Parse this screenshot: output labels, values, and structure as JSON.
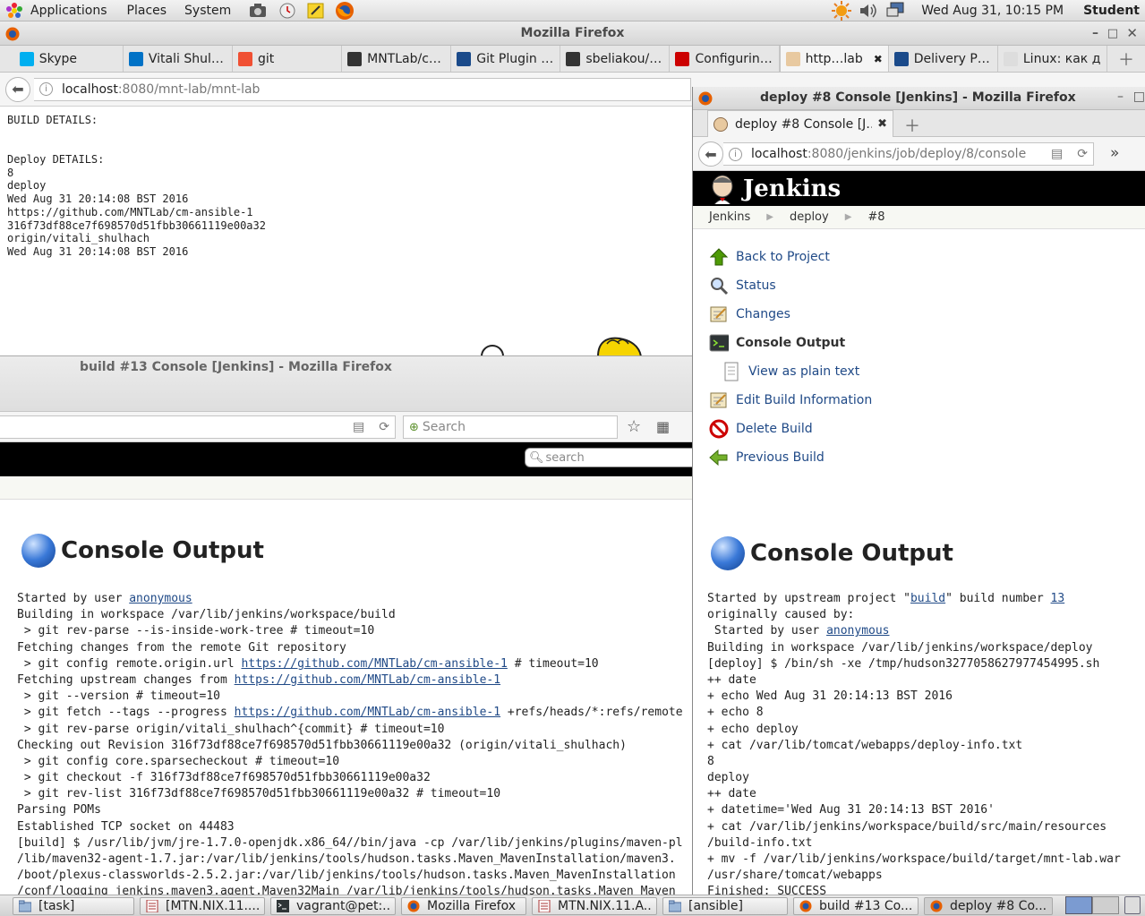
{
  "topbar": {
    "menus": [
      "Applications",
      "Places",
      "System"
    ],
    "clock": "Wed Aug 31, 10:15 PM",
    "user": "Student"
  },
  "main_window": {
    "title": "Mozilla Firefox",
    "tabs": [
      "Skype",
      "Vitali Shul…",
      "git",
      "MNTLab/c…",
      "Git Plugin …",
      "sbeliakou/…",
      "Configurin…",
      "http…lab",
      "Delivery P…",
      "Linux: как до…"
    ],
    "active_tab": 7,
    "url_host": "localhost",
    "url_rest": ":8080/mnt-lab/mnt-lab",
    "page_lines": [
      "BUILD DETAILS:",
      "",
      "",
      "Deploy DETAILS:",
      "8",
      "deploy",
      "Wed Aug 31 20:14:08 BST 2016",
      "https://github.com/MNTLab/cm-ansible-1",
      "316f73df88ce7f698570d51fbb30661119e00a32",
      "origin/vitali_shulhach",
      "Wed Aug 31 20:14:08 BST 2016"
    ]
  },
  "back_window": {
    "title": "build #13 Console [Jenkins] - Mozilla Firefox",
    "search_placeholder": "Search",
    "jenkins_search_placeholder": "search",
    "heading": "Console Output",
    "lines": [
      [
        {
          "t": "Started by user "
        },
        {
          "t": "anonymous",
          "link": true
        }
      ],
      [
        {
          "t": "Building in workspace /var/lib/jenkins/workspace/build"
        }
      ],
      [
        {
          "t": " > git rev-parse --is-inside-work-tree # timeout=10"
        }
      ],
      [
        {
          "t": "Fetching changes from the remote Git repository"
        }
      ],
      [
        {
          "t": " > git config remote.origin.url "
        },
        {
          "t": "https://github.com/MNTLab/cm-ansible-1",
          "link": true
        },
        {
          "t": " # timeout=10"
        }
      ],
      [
        {
          "t": "Fetching upstream changes from "
        },
        {
          "t": "https://github.com/MNTLab/cm-ansible-1",
          "link": true
        }
      ],
      [
        {
          "t": " > git --version # timeout=10"
        }
      ],
      [
        {
          "t": " > git fetch --tags --progress "
        },
        {
          "t": "https://github.com/MNTLab/cm-ansible-1",
          "link": true
        },
        {
          "t": " +refs/heads/*:refs/remote"
        }
      ],
      [
        {
          "t": " > git rev-parse origin/vitali_shulhach^{commit} # timeout=10"
        }
      ],
      [
        {
          "t": "Checking out Revision 316f73df88ce7f698570d51fbb30661119e00a32 (origin/vitali_shulhach)"
        }
      ],
      [
        {
          "t": " > git config core.sparsecheckout # timeout=10"
        }
      ],
      [
        {
          "t": " > git checkout -f 316f73df88ce7f698570d51fbb30661119e00a32"
        }
      ],
      [
        {
          "t": " > git rev-list 316f73df88ce7f698570d51fbb30661119e00a32 # timeout=10"
        }
      ],
      [
        {
          "t": "Parsing POMs"
        }
      ],
      [
        {
          "t": "Established TCP socket on 44483"
        }
      ],
      [
        {
          "t": "[build] $ /usr/lib/jvm/jre-1.7.0-openjdk.x86_64//bin/java -cp /var/lib/jenkins/plugins/maven-pl"
        }
      ],
      [
        {
          "t": "/lib/maven32-agent-1.7.jar:/var/lib/jenkins/tools/hudson.tasks.Maven_MavenInstallation/maven3."
        }
      ],
      [
        {
          "t": "/boot/plexus-classworlds-2.5.2.jar:/var/lib/jenkins/tools/hudson.tasks.Maven_MavenInstallation"
        }
      ],
      [
        {
          "t": "/conf/logging jenkins.maven3.agent.Maven32Main /var/lib/jenkins/tools/hudson.tasks.Maven_Maven"
        }
      ]
    ]
  },
  "right_window": {
    "title": "deploy #8 Console [Jenkins] - Mozilla Firefox",
    "tab_label": "deploy #8 Console [J…",
    "url_host": "localhost",
    "url_rest": ":8080/jenkins/job/deploy/8/console",
    "brand": "Jenkins",
    "breadcrumb": [
      "Jenkins",
      "deploy",
      "#8"
    ],
    "sidebar": [
      {
        "label": "Back to Project",
        "icon": "up-arrow-icon"
      },
      {
        "label": "Status",
        "icon": "magnifier-icon"
      },
      {
        "label": "Changes",
        "icon": "notepad-icon"
      },
      {
        "label": "Console Output",
        "icon": "terminal-icon",
        "current": true
      },
      {
        "label": "View as plain text",
        "icon": "document-icon",
        "sub": true
      },
      {
        "label": "Edit Build Information",
        "icon": "notepad-icon"
      },
      {
        "label": "Delete Build",
        "icon": "no-entry-icon"
      },
      {
        "label": "Previous Build",
        "icon": "left-arrow-icon"
      }
    ],
    "heading": "Console Output",
    "lines": [
      [
        {
          "t": "Started by upstream project \""
        },
        {
          "t": "build",
          "link": true
        },
        {
          "t": "\" build number "
        },
        {
          "t": "13",
          "link": true
        }
      ],
      [
        {
          "t": "originally caused by:"
        }
      ],
      [
        {
          "t": " Started by user "
        },
        {
          "t": "anonymous",
          "link": true
        }
      ],
      [
        {
          "t": "Building in workspace /var/lib/jenkins/workspace/deploy"
        }
      ],
      [
        {
          "t": "[deploy] $ /bin/sh -xe /tmp/hudson3277058627977454995.sh"
        }
      ],
      [
        {
          "t": "++ date"
        }
      ],
      [
        {
          "t": "+ echo Wed Aug 31 20:14:13 BST 2016"
        }
      ],
      [
        {
          "t": "+ echo 8"
        }
      ],
      [
        {
          "t": "+ echo deploy"
        }
      ],
      [
        {
          "t": "+ cat /var/lib/tomcat/webapps/deploy-info.txt"
        }
      ],
      [
        {
          "t": "8"
        }
      ],
      [
        {
          "t": "deploy"
        }
      ],
      [
        {
          "t": "++ date"
        }
      ],
      [
        {
          "t": "+ datetime='Wed Aug 31 20:14:13 BST 2016'"
        }
      ],
      [
        {
          "t": "+ cat /var/lib/jenkins/workspace/build/src/main/resources"
        }
      ],
      [
        {
          "t": "/build-info.txt"
        }
      ],
      [
        {
          "t": "+ mv -f /var/lib/jenkins/workspace/build/target/mnt-lab.war"
        }
      ],
      [
        {
          "t": "/usr/share/tomcat/webapps"
        }
      ],
      [
        {
          "t": "Finished: SUCCESS"
        }
      ]
    ]
  },
  "taskbar": {
    "items": [
      {
        "label": "[task]",
        "icon": "folder-icon"
      },
      {
        "label": "[MTN.NIX.11....",
        "icon": "document-icon"
      },
      {
        "label": "vagrant@pet:...",
        "icon": "terminal-icon"
      },
      {
        "label": "Mozilla Firefox",
        "icon": "firefox-icon"
      },
      {
        "label": "MTN.NIX.11.A...",
        "icon": "document-icon"
      },
      {
        "label": "[ansible]",
        "icon": "folder-icon"
      },
      {
        "label": "build #13 Co...",
        "icon": "firefox-icon"
      },
      {
        "label": "deploy #8 Co...",
        "icon": "firefox-icon",
        "active": true
      }
    ]
  },
  "colors": {
    "link": "#204a87",
    "jenkins_header": "#000000",
    "accent_blue": "#3465a4"
  }
}
